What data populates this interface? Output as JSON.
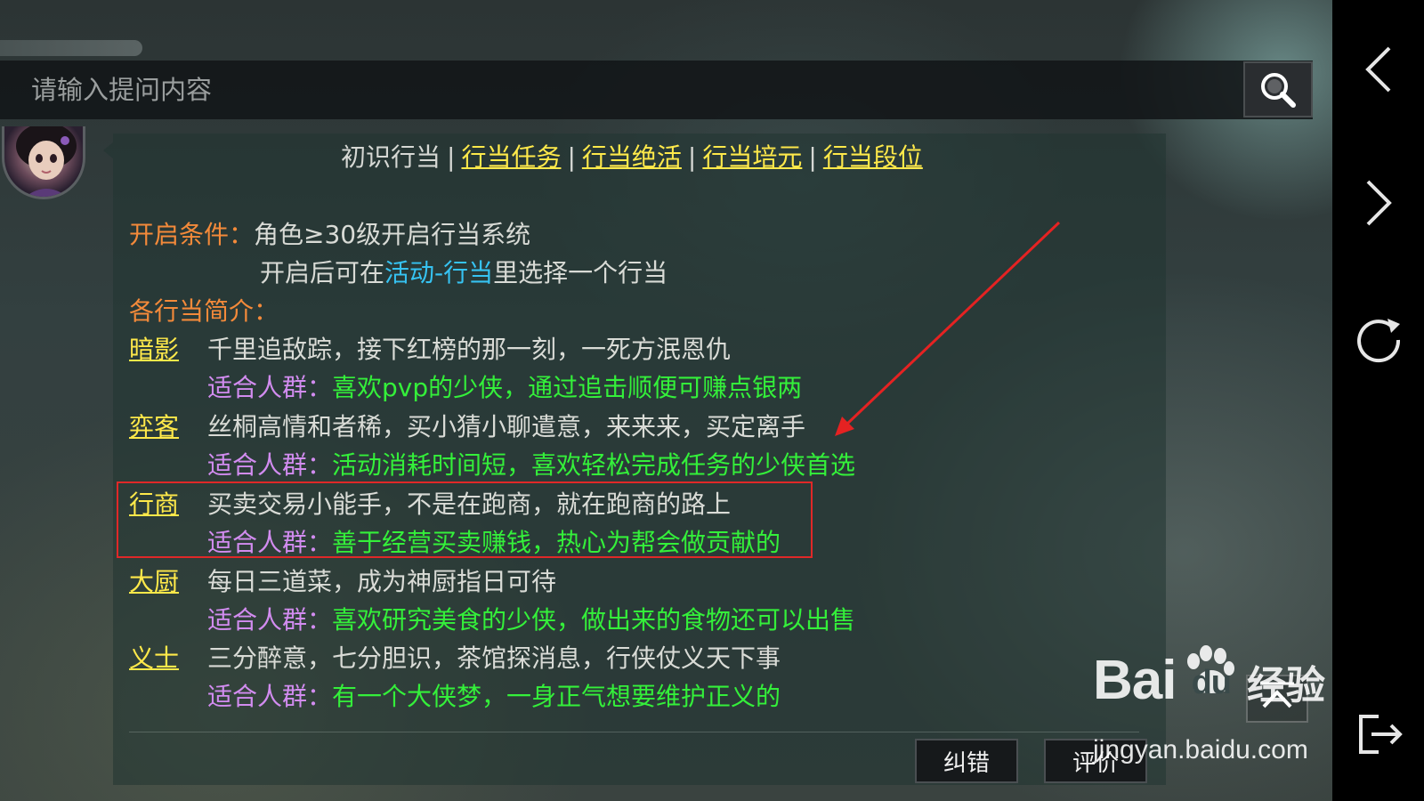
{
  "search": {
    "placeholder": "请输入提问内容"
  },
  "nav_links": [
    {
      "label": "初识行当",
      "is_link": false
    },
    {
      "label": "行当任务",
      "is_link": true
    },
    {
      "label": "行当绝活",
      "is_link": true
    },
    {
      "label": "行当培元",
      "is_link": true
    },
    {
      "label": "行当段位",
      "is_link": true
    }
  ],
  "nav_separator": "|",
  "content": {
    "open_condition_label": "开启条件：",
    "open_condition_text": "角色≥30级开启行当系统",
    "open_after_prefix": "开启后可在",
    "open_after_link": "活动-行当",
    "open_after_suffix": "里选择一个行当",
    "intro_label": "各行当简介：",
    "audience_label": "适合人群：",
    "professions": [
      {
        "name": "暗影",
        "desc": "千里追敌踪，接下红榜的那一刻，一死方泯恩仇",
        "audience": "喜欢pvp的少侠，通过追击顺便可赚点银两"
      },
      {
        "name": "弈客",
        "desc": "丝桐高情和者稀，买小猜小聊遣意，来来来，买定离手",
        "audience": "活动消耗时间短，喜欢轻松完成任务的少侠首选"
      },
      {
        "name": "行商",
        "desc": "买卖交易小能手，不是在跑商，就在跑商的路上",
        "audience": "善于经营买卖赚钱，热心为帮会做贡献的"
      },
      {
        "name": "大厨",
        "desc": "每日三道菜，成为神厨指日可待",
        "audience": "喜欢研究美食的少侠，做出来的食物还可以出售"
      },
      {
        "name": "义士",
        "desc": "三分醉意，七分胆识，茶馆探消息，行侠仗义天下事",
        "audience": "有一个大侠梦，一身正气想要维护正义的"
      }
    ]
  },
  "footer": {
    "correct_label": "纠错",
    "rate_label": "评价"
  },
  "watermark": {
    "brand": "Bai",
    "brand_tail": "du",
    "suffix": "经验",
    "url": "jingyan.baidu.com"
  },
  "colors": {
    "link_yellow": "#ffe94a",
    "label_orange": "#f48a3a",
    "audience_purple": "#d28cf0",
    "audience_green": "#34f03a",
    "highlight_red": "#e02828",
    "inline_link_cyan": "#36c3f2"
  },
  "icons": {
    "search": "search-icon",
    "back": "chevron-left-icon",
    "forward": "chevron-right-icon",
    "refresh": "refresh-icon",
    "exit": "exit-icon",
    "scroll_top": "scroll-to-top-icon"
  }
}
